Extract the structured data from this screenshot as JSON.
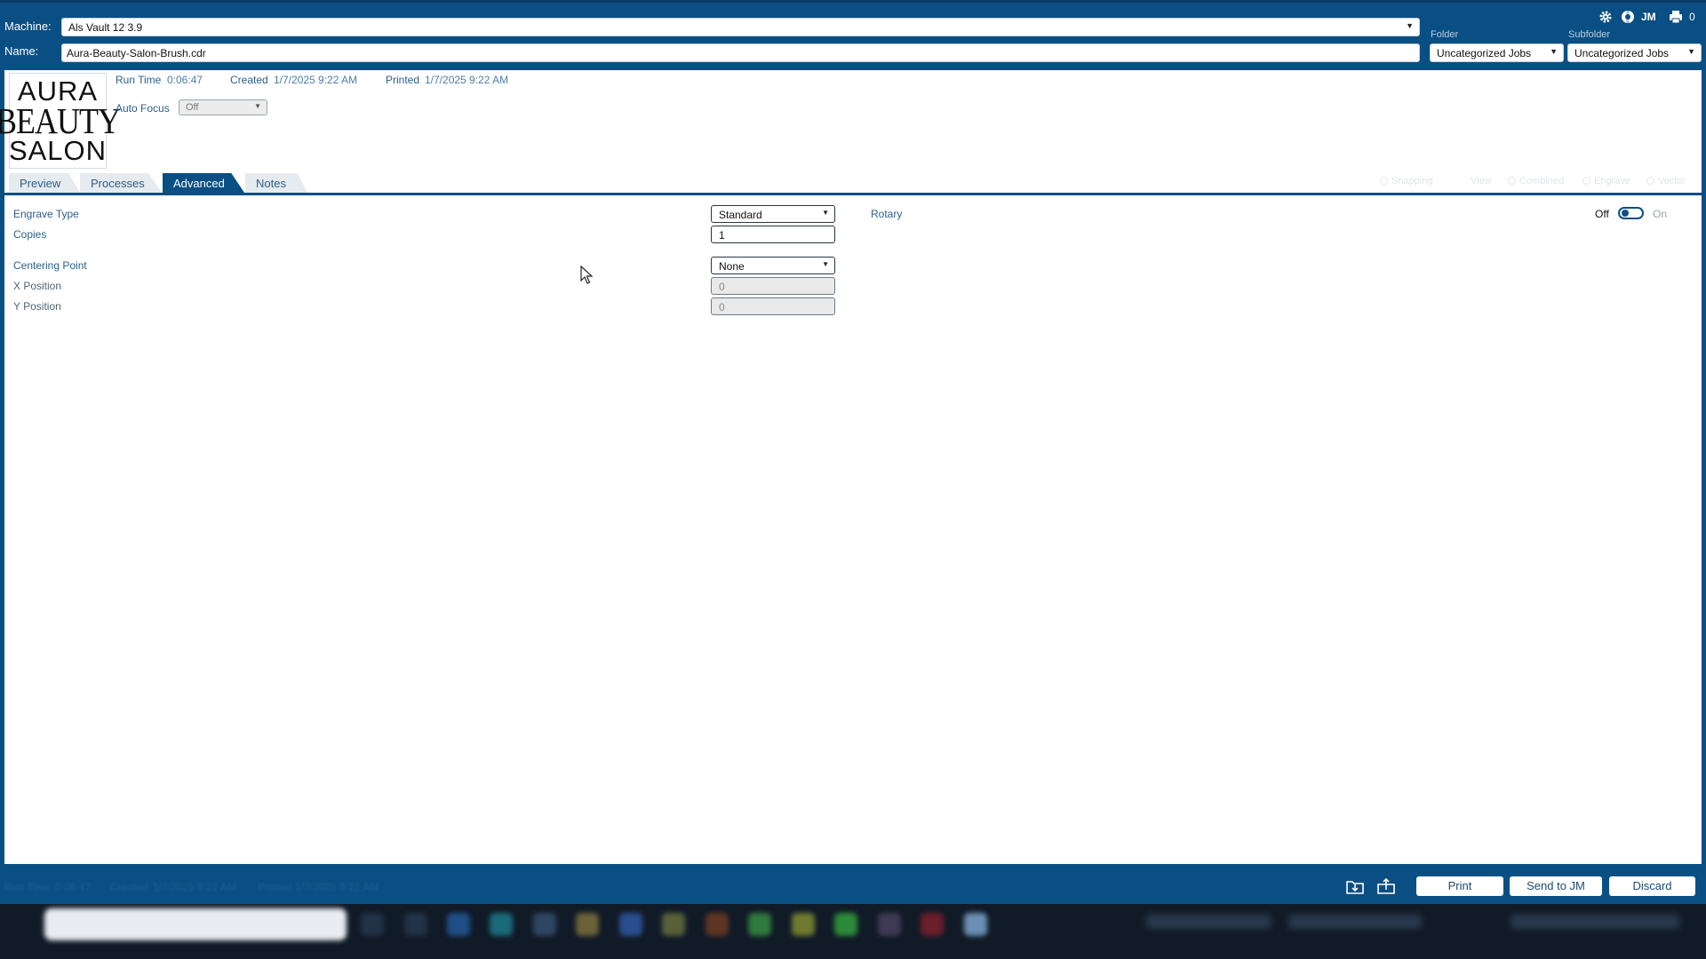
{
  "header": {
    "machine_label": "Machine:",
    "machine_value": "Als Vault 12 3.9",
    "name_label": "Name:",
    "name_value": "Aura-Beauty-Salon-Brush.cdr",
    "folder_label": "Folder",
    "folder_value": "Uncategorized Jobs",
    "subfolder_label": "Subfolder",
    "subfolder_value": "Uncategorized Jobs",
    "user_initials": "JM",
    "print_queue_count": "0",
    "icons": [
      "gear-icon",
      "help-icon",
      "printer-icon"
    ]
  },
  "logo": {
    "line1": "AURA",
    "line2": "BEAUTY",
    "line3": "SALON"
  },
  "info": {
    "run_time_label": "Run Time",
    "run_time_value": "0:06:47",
    "created_label": "Created",
    "created_value": "1/7/2025 9:22 AM",
    "printed_label": "Printed",
    "printed_value": "1/7/2025 9:22 AM",
    "auto_focus_label": "Auto Focus",
    "auto_focus_value": "Off"
  },
  "tabs": [
    {
      "label": "Preview",
      "active": false
    },
    {
      "label": "Processes",
      "active": false
    },
    {
      "label": "Advanced",
      "active": true
    },
    {
      "label": "Notes",
      "active": false
    }
  ],
  "preview_options": {
    "snapping_label": "Snapping",
    "view_label": "View",
    "combined_label": "Combined",
    "engrave_label": "Engrave",
    "vector_label": "Vector"
  },
  "advanced": {
    "engrave_type_label": "Engrave Type",
    "engrave_type_value": "Standard",
    "copies_label": "Copies",
    "copies_value": "1",
    "centering_point_label": "Centering Point",
    "centering_point_value": "None",
    "x_position_label": "X Position",
    "x_position_value": "0",
    "y_position_label": "Y Position",
    "y_position_value": "0",
    "rotary_label": "Rotary",
    "rotary_off_label": "Off",
    "rotary_on_label": "On",
    "rotary_state": "off"
  },
  "footer": {
    "run_time_label": "Run Time",
    "run_time_value": "0:06:47",
    "created_label": "Created",
    "created_value": "1/7/2025 9:22 AM",
    "printed_label": "Printed",
    "printed_value": "1/7/2025 9:22 AM",
    "print_label": "Print",
    "send_label": "Send to JM",
    "discard_label": "Discard",
    "icons": [
      "import-icon",
      "export-icon"
    ]
  },
  "colors": {
    "brand_blue": "#0a4f83",
    "label_blue": "#2b5f8a",
    "taskbar": "#111a27"
  }
}
